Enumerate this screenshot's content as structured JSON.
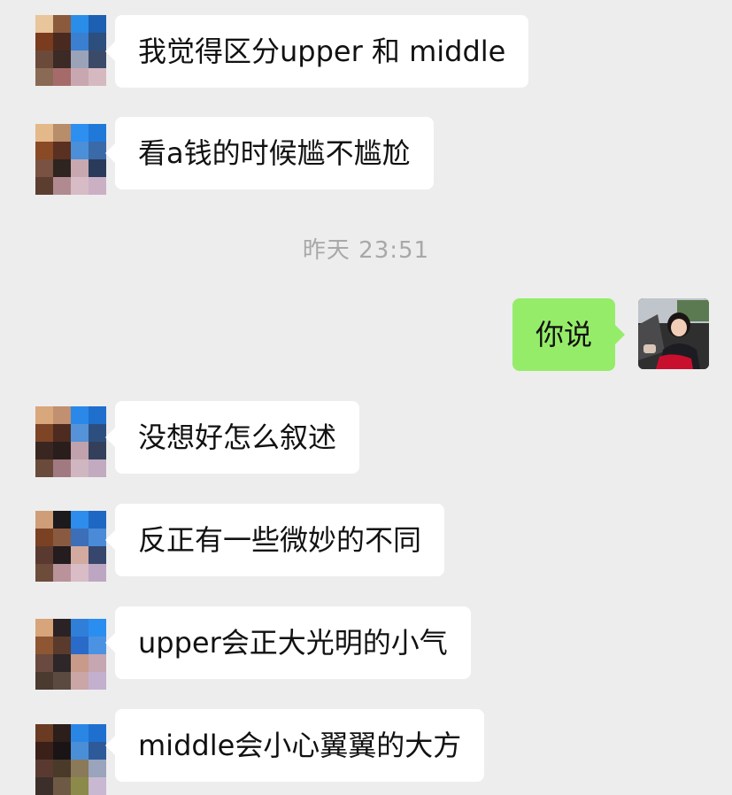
{
  "messages": [
    {
      "side": "left",
      "text": "我觉得区分upper 和 middle"
    },
    {
      "side": "left",
      "text": "看a钱的时候尴不尴尬"
    },
    {
      "side": "right",
      "text": "你说"
    },
    {
      "side": "left",
      "text": "没想好怎么叙述"
    },
    {
      "side": "left",
      "text": "反正有一些微妙的不同"
    },
    {
      "side": "left",
      "text": "upper会正大光明的小气"
    },
    {
      "side": "left",
      "text": "middle会小心翼翼的大方"
    }
  ],
  "timestamp": "昨天 23:51",
  "colors": {
    "background": "#ededed",
    "incoming_bubble": "#ffffff",
    "outgoing_bubble": "#95ec69",
    "timestamp_text": "#a8a8a8"
  },
  "avatars": {
    "contact": "pixelated-avatar",
    "self": "user-photo-avatar"
  }
}
